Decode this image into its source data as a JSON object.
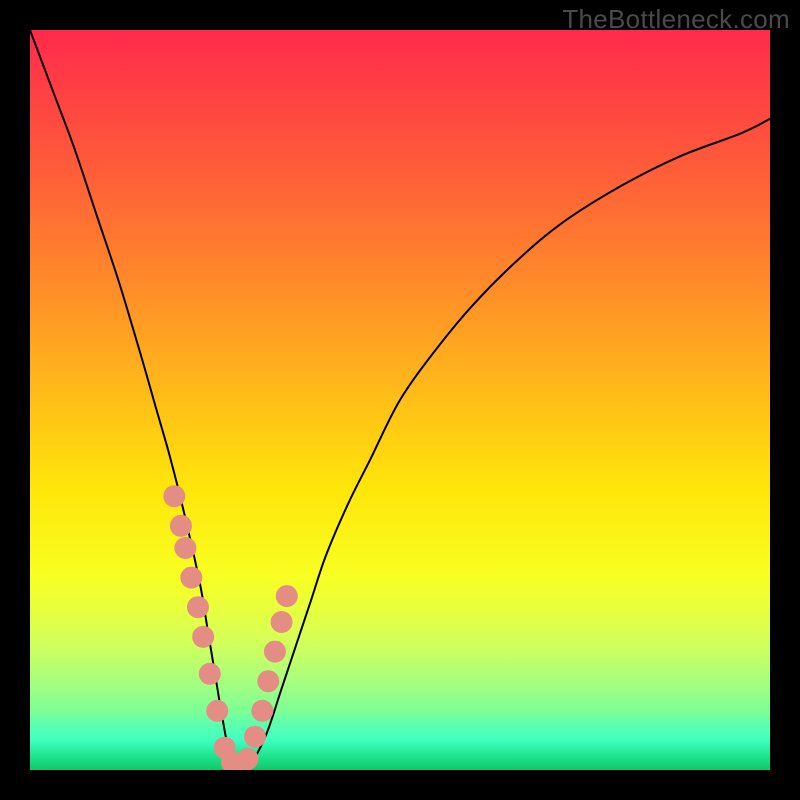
{
  "watermark": "TheBottleneck.com",
  "chart_data": {
    "type": "line",
    "title": "",
    "xlabel": "",
    "ylabel": "",
    "xlim": [
      0,
      100
    ],
    "ylim": [
      0,
      100
    ],
    "x": [
      0,
      3,
      6,
      9,
      12,
      15,
      17,
      19,
      21,
      23,
      24,
      25,
      26,
      27,
      28,
      29,
      30,
      32,
      34,
      36,
      38,
      40,
      43,
      46,
      50,
      55,
      60,
      66,
      72,
      80,
      88,
      96,
      100
    ],
    "y": [
      100,
      92,
      84,
      75,
      66,
      56,
      49,
      42,
      34,
      25,
      19,
      13,
      7,
      2,
      0,
      0,
      1,
      5,
      11,
      17,
      23,
      29,
      36,
      42,
      50,
      57,
      63,
      69,
      74,
      79,
      83,
      86,
      88
    ],
    "markers": {
      "x": [
        19.5,
        20.4,
        21.0,
        21.8,
        22.7,
        23.4,
        24.3,
        25.3,
        26.3,
        27.3,
        28.6,
        29.4,
        30.4,
        31.4,
        32.2,
        33.1,
        34.0,
        34.7
      ],
      "y": [
        37,
        33,
        30,
        26,
        22,
        18,
        13,
        8,
        3,
        1,
        0.7,
        1.5,
        4.5,
        8,
        12,
        16,
        20,
        23.5
      ],
      "color": "#e38d84",
      "size": 11
    },
    "line_color": "#000000",
    "line_width": 2
  }
}
